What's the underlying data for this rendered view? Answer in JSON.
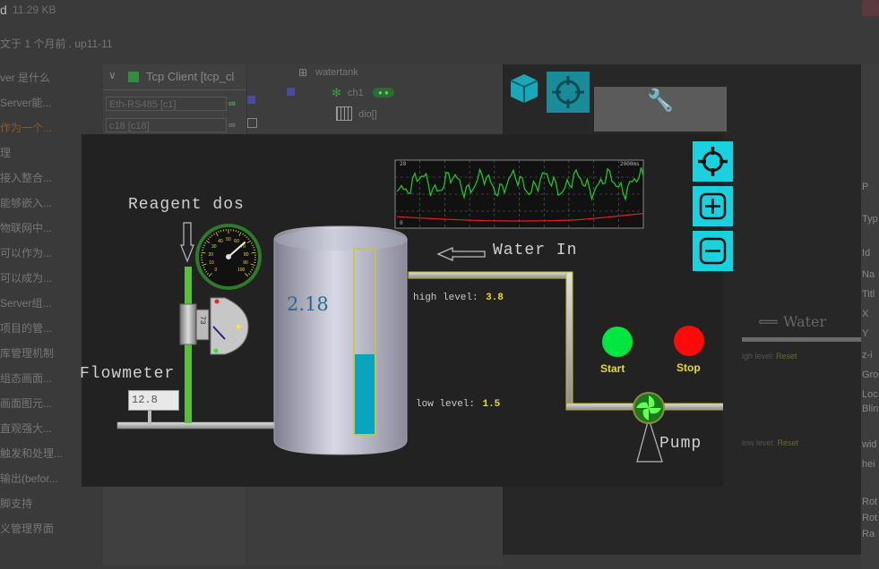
{
  "background": {
    "top_status": "11.29 KB",
    "top_letter": "d",
    "info_line": "文于 1 个月前 . up11-11",
    "left_list": [
      "ver 是什么",
      "Server能...",
      "作为一个...",
      "理",
      "接入整合...",
      "能够嵌入...",
      "物联网中...",
      "可以作为...",
      "可以成为...",
      "Server组...",
      "项目的管...",
      "库管理机制",
      "组态画面...",
      "画面图元...",
      "直观强大...",
      "触发和处理...",
      "输出(befor...",
      "脚支持",
      "义管理界面"
    ],
    "tab_title": "Tcp Client [tcp_cl",
    "inputs": [
      "Eth-RS485 [c1]",
      "c18 [c18]"
    ],
    "tree_root": "watertank",
    "tree_child": "ch1",
    "tree_badge": "●  ●",
    "tree_leaf": "dio[]",
    "right_props": [
      "P",
      "Typ",
      "Id",
      "Na",
      "Titl",
      "X",
      "Y",
      "z-i",
      "Gro",
      "Loc",
      "Blin",
      "wid",
      "hei",
      "Rot",
      "Rot",
      "Ra"
    ]
  },
  "hmi": {
    "title_reagent": "Reagent dos",
    "flowmeter_label": "Flowmeter",
    "flowmeter_value": "12.8",
    "tank_value": "2.18",
    "water_in_label": "Water In",
    "high_level_label": "high level:",
    "high_level_value": "3.8",
    "low_level_label": "low  level:",
    "low_level_value": "1.5",
    "start_label": "Start",
    "stop_label": "Stop",
    "pump_label": "Pump",
    "meter_small_value": "73",
    "gauge_ticks": [
      "0",
      "10",
      "20",
      "30",
      "40",
      "50",
      "60",
      "70",
      "80",
      "90",
      "100"
    ],
    "trend_top_left": "20",
    "trend_top_right": "2000ms",
    "trend_bottom_left": "0",
    "level_fraction": 0.43,
    "gauge_value": 68,
    "colors": {
      "start": "#00e640",
      "stop": "#ff0a0a",
      "liquid": "#0aa3c0",
      "pipe": "#b8b8b8",
      "tool": "#1ad1e0"
    }
  },
  "ghost": {
    "water_label": "Water",
    "high_level_label": "igh level:",
    "high_level_value": "Reset",
    "low_level_label": "low  level:",
    "low_level_value": "Reset"
  },
  "tools": {
    "locate_icon": "crosshair-icon",
    "zoom_in_icon": "zoom-in-icon",
    "zoom_out_icon": "zoom-out-icon"
  }
}
